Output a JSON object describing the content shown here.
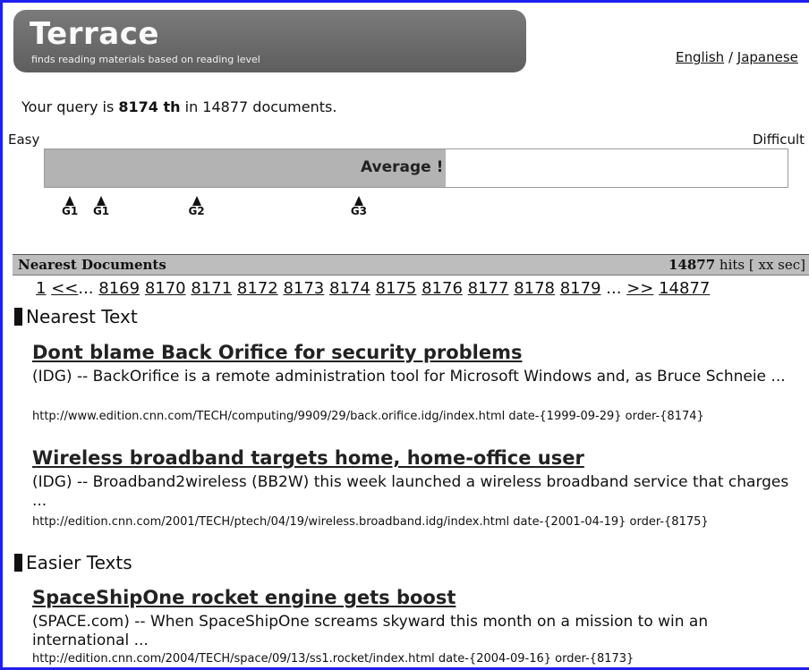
{
  "logo": {
    "title": "Terrace",
    "subtitle": "finds reading materials based on reading level"
  },
  "lang": {
    "english": "English",
    "separator": " / ",
    "japanese": "Japanese"
  },
  "query": {
    "prefix": "Your query is ",
    "rank": "8174 th",
    "middle": " in ",
    "total": "14877",
    "suffix": " documents."
  },
  "scale": {
    "easy_label": "Easy",
    "difficult_label": "Difficult",
    "level_label": "Average",
    "level_mark": " !",
    "fill_fraction": 0.54
  },
  "markers": [
    {
      "label": "G1",
      "position": 0.035
    },
    {
      "label": "G1",
      "position": 0.077
    },
    {
      "label": "G2",
      "position": 0.205
    },
    {
      "label": "G3",
      "position": 0.423
    }
  ],
  "section": {
    "title": "Nearest Documents",
    "hits_count": "14877",
    "hits_suffix": " hits [ xx sec]"
  },
  "pager": {
    "first": "1",
    "prev": "<<",
    "ellipsis_left": "...",
    "pages": [
      "8169",
      "8170",
      "8171",
      "8172",
      "8173",
      "8174",
      "8175",
      "8176",
      "8177",
      "8178",
      "8179"
    ],
    "ellipsis_right": "...",
    "next": ">>",
    "last": "14877"
  },
  "groups": {
    "nearest": "Nearest Text",
    "easier": "Easier Texts"
  },
  "documents": [
    {
      "title": "Dont blame Back Orifice for security problems",
      "snippet": "(IDG) -- BackOrifice is a remote administration tool for Microsoft Windows and, as Bruce Schneie ...",
      "meta": "http://www.edition.cnn.com/TECH/computing/9909/29/back.orifice.idg/index.html date-{1999-09-29} order-{8174}"
    },
    {
      "title": "Wireless broadband targets home, home-office user",
      "snippet": "(IDG) -- Broadband2wireless (BB2W) this week launched a wireless broadband service that charges ...",
      "meta": "http://edition.cnn.com/2001/TECH/ptech/04/19/wireless.broadband.idg/index.html date-{2001-04-19} order-{8175}"
    },
    {
      "title": "SpaceShipOne rocket engine gets boost",
      "snippet": "(SPACE.com) -- When SpaceShipOne screams skyward this month on a mission to win an international ...",
      "meta": "http://edition.cnn.com/2004/TECH/space/09/13/ss1.rocket/index.html date-{2004-09-16} order-{8173}"
    }
  ]
}
